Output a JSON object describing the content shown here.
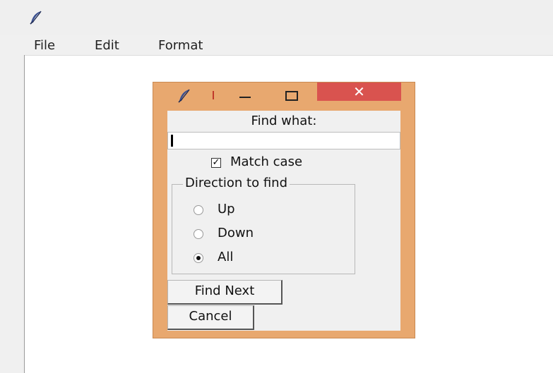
{
  "window": {
    "icon": "feather-icon"
  },
  "menu": {
    "items": [
      "File",
      "Edit",
      "Format"
    ]
  },
  "dialog": {
    "icon": "feather-icon",
    "title_mark": "ı",
    "minimize_symbol": "—",
    "maximize_symbol": "☐",
    "close_symbol": "✕",
    "find_label": "Find what:",
    "find_value": "",
    "match_case_label": "Match case",
    "match_case_checked": true,
    "direction": {
      "title": "Direction to find",
      "options": [
        "Up",
        "Down",
        "All"
      ],
      "selected": "All"
    },
    "buttons": {
      "find_next": "Find Next",
      "cancel": "Cancel"
    }
  },
  "colors": {
    "dialog_frame": "#e8a86f",
    "close_button": "#d9534f",
    "client": "#f0f0f0"
  }
}
